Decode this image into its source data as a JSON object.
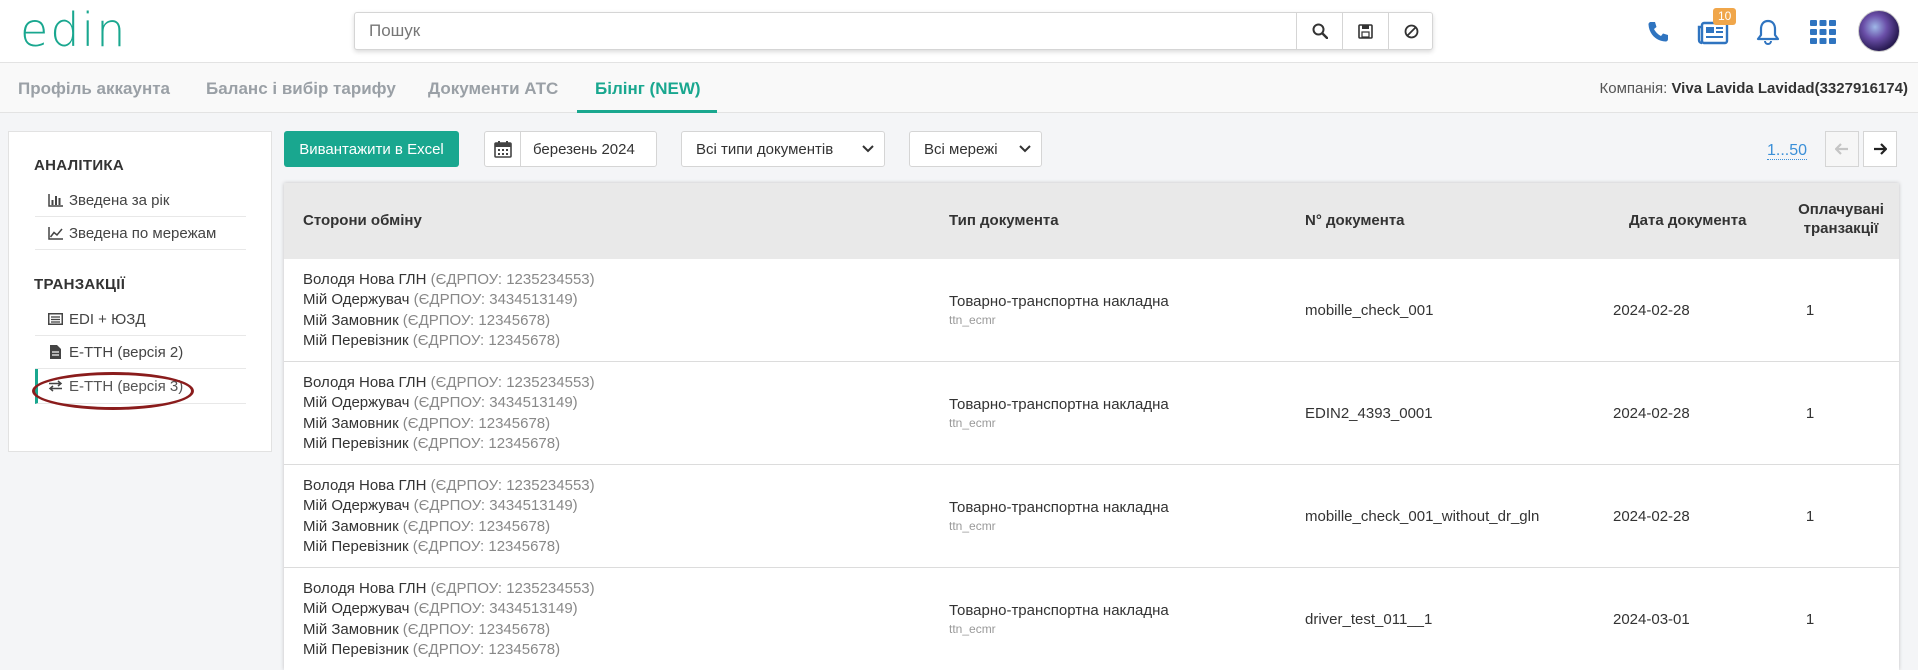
{
  "brand": {
    "logo_text": "edin",
    "accent": "#19a78f"
  },
  "search": {
    "placeholder": "Пошук"
  },
  "header": {
    "notifications_count": "10"
  },
  "tabs": [
    {
      "label": "Профіль аккаунта"
    },
    {
      "label": "Баланс і вибір тарифу"
    },
    {
      "label": "Документи АТС"
    },
    {
      "label": "Білінг (NEW)",
      "active": true
    }
  ],
  "company": {
    "label": "Компанія:",
    "name": "Viva Lavida Lavidad(3327916174)"
  },
  "sidebar": {
    "analytics_title": "АНАЛІТИКА",
    "analytics_items": [
      {
        "label": "Зведена за рік",
        "icon": "bar-chart-icon"
      },
      {
        "label": "Зведена по мережам",
        "icon": "line-chart-icon"
      }
    ],
    "transactions_title": "ТРАНЗАКЦІЇ",
    "transaction_items": [
      {
        "label": "EDI + ЮЗД",
        "icon": "list-icon"
      },
      {
        "label": "Е-ТТН (версія 2)",
        "icon": "document-icon"
      },
      {
        "label": "Е-ТТН (версія 3)",
        "icon": "exchange-icon",
        "active": true
      }
    ]
  },
  "toolbar": {
    "export_label": "Вивантажити в Excel",
    "date_value": "березень 2024",
    "doc_type_filter": "Всі типи документів",
    "network_filter": "Всі мережі",
    "pager_label": "1...50"
  },
  "table": {
    "headers": {
      "parties": "Сторони обміну",
      "doc_type": "Тип документа",
      "doc_number": "N° документа",
      "doc_date": "Дата документа",
      "paid_line1": "Оплачувані",
      "paid_line2": "транзакції"
    },
    "rows": [
      {
        "parties": [
          {
            "name": "Володя Нова ГЛН",
            "code": "(ЄДРПОУ: 1235234553)"
          },
          {
            "name": "Мій Одержувач",
            "code": "(ЄДРПОУ: 3434513149)"
          },
          {
            "name": "Мій Замовник",
            "code": "(ЄДРПОУ: 12345678)"
          },
          {
            "name": "Мій Перевізник",
            "code": "(ЄДРПОУ: 12345678)"
          }
        ],
        "doc_type": "Товарно-транспортна накладна",
        "doc_subtype": "ttn_ecmr",
        "doc_number": "mobille_check_001",
        "doc_date": "2024-02-28",
        "paid": "1"
      },
      {
        "parties": [
          {
            "name": "Володя Нова ГЛН",
            "code": "(ЄДРПОУ: 1235234553)"
          },
          {
            "name": "Мій Одержувач",
            "code": "(ЄДРПОУ: 3434513149)"
          },
          {
            "name": "Мій Замовник",
            "code": "(ЄДРПОУ: 12345678)"
          },
          {
            "name": "Мій Перевізник",
            "code": "(ЄДРПОУ: 12345678)"
          }
        ],
        "doc_type": "Товарно-транспортна накладна",
        "doc_subtype": "ttn_ecmr",
        "doc_number": "EDIN2_4393_0001",
        "doc_date": "2024-02-28",
        "paid": "1"
      },
      {
        "parties": [
          {
            "name": "Володя Нова ГЛН",
            "code": "(ЄДРПОУ: 1235234553)"
          },
          {
            "name": "Мій Одержувач",
            "code": "(ЄДРПОУ: 3434513149)"
          },
          {
            "name": "Мій Замовник",
            "code": "(ЄДРПОУ: 12345678)"
          },
          {
            "name": "Мій Перевізник",
            "code": "(ЄДРПОУ: 12345678)"
          }
        ],
        "doc_type": "Товарно-транспортна накладна",
        "doc_subtype": "ttn_ecmr",
        "doc_number": "mobille_check_001_without_dr_gln",
        "doc_date": "2024-02-28",
        "paid": "1"
      },
      {
        "parties": [
          {
            "name": "Володя Нова ГЛН",
            "code": "(ЄДРПОУ: 1235234553)"
          },
          {
            "name": "Мій Одержувач",
            "code": "(ЄДРПОУ: 3434513149)"
          },
          {
            "name": "Мій Замовник",
            "code": "(ЄДРПОУ: 12345678)"
          },
          {
            "name": "Мій Перевізник",
            "code": "(ЄДРПОУ: 12345678)"
          }
        ],
        "doc_type": "Товарно-транспортна накладна",
        "doc_subtype": "ttn_ecmr",
        "doc_number": "driver_test_011__1",
        "doc_date": "2024-03-01",
        "paid": "1"
      }
    ]
  }
}
